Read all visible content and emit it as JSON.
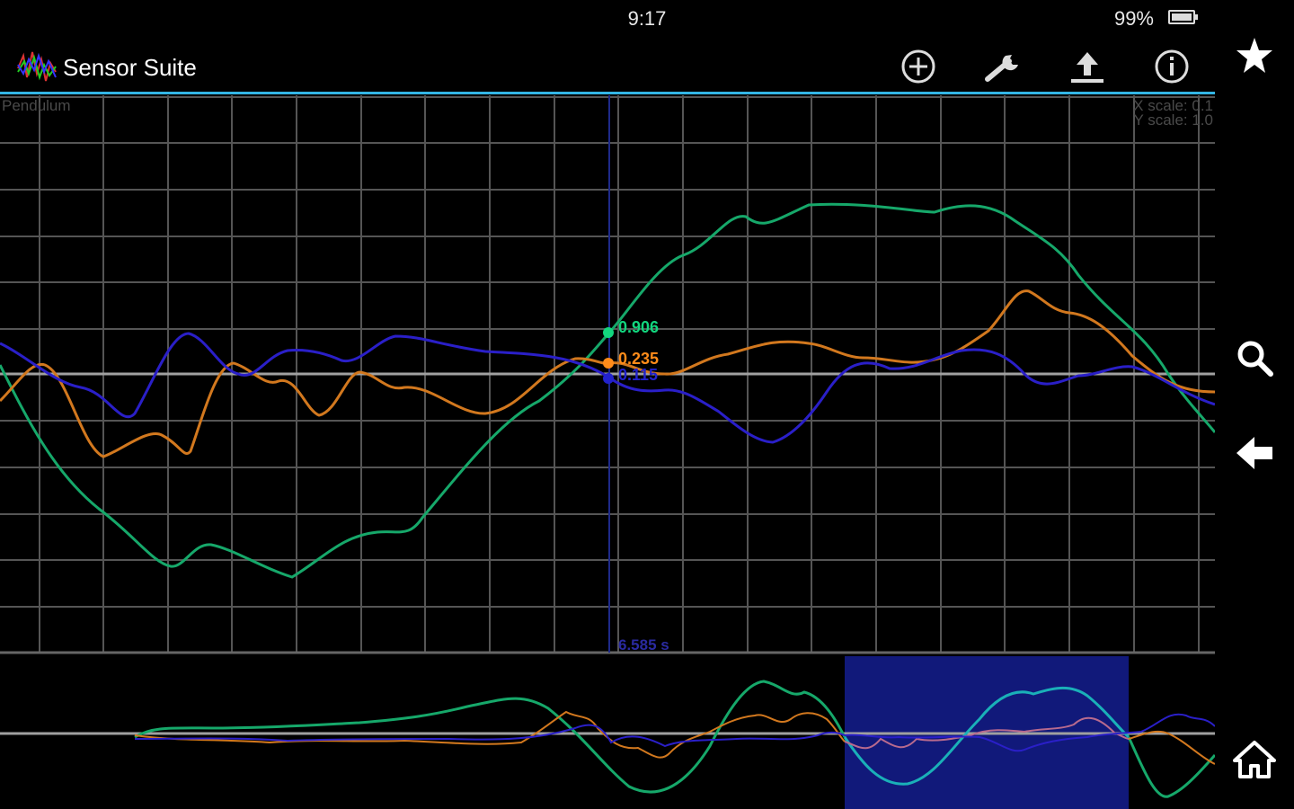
{
  "status_bar": {
    "time": "9:17",
    "battery": "99%",
    "battery_icon": "battery-icon"
  },
  "action_bar": {
    "title": "Sensor Suite",
    "logo_icon": "waveform-logo-icon",
    "actions": [
      {
        "name": "add-button",
        "icon": "plus-circle-icon"
      },
      {
        "name": "settings-button",
        "icon": "wrench-icon"
      },
      {
        "name": "upload-button",
        "icon": "upload-icon"
      },
      {
        "name": "info-button",
        "icon": "info-circle-icon"
      }
    ]
  },
  "nav": {
    "items": [
      {
        "name": "favorite-button",
        "icon": "star-icon"
      },
      {
        "name": "search-button",
        "icon": "search-icon"
      },
      {
        "name": "back-button",
        "icon": "arrow-left-icon"
      },
      {
        "name": "home-button",
        "icon": "home-icon"
      }
    ]
  },
  "graph": {
    "name": "Pendulum",
    "x_scale": "X scale: 0.1",
    "y_scale": "Y scale: 1.0",
    "cursor": {
      "time": "6.585 s",
      "values": [
        {
          "text": "0.906",
          "color": "#12d67e"
        },
        {
          "text": "0.235",
          "color": "#ff8c1a"
        },
        {
          "text": "0.115",
          "color": "#2222cc"
        }
      ]
    }
  },
  "colors": {
    "accent": "#33b5e5",
    "series_green": "#16a86a",
    "series_orange": "#d2781e",
    "series_blue": "#2a1fc8",
    "series_cyan": "#1ab0b8",
    "grid": "#555555",
    "zero_line": "#999999",
    "overview_window": "#11197a"
  }
}
